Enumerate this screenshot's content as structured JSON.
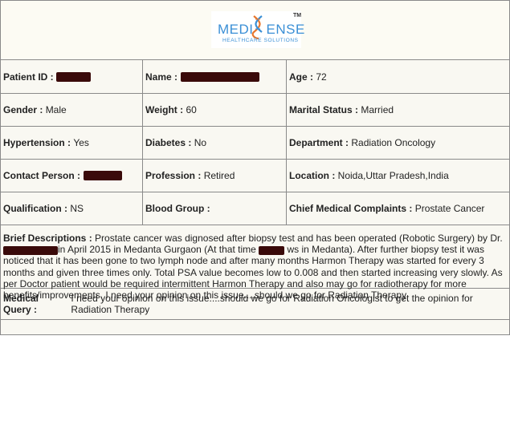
{
  "logo": {
    "brand_left": "MEDI",
    "brand_right": "ENSE",
    "tagline": "HEALTHCARE SOLUTIONS",
    "tm": "TM",
    "icon": "dna-helix-icon",
    "color": "#3a8fd6"
  },
  "fields": {
    "patient_id_label": "Patient ID :",
    "name_label": "Name :",
    "age_label": "Age :",
    "age_value": "72",
    "gender_label": "Gender :",
    "gender_value": "Male",
    "weight_label": "Weight :",
    "weight_value": "60",
    "marital_label": "Marital Status :",
    "marital_value": "Married",
    "hypertension_label": "Hypertension :",
    "hypertension_value": "Yes",
    "diabetes_label": "Diabetes :",
    "diabetes_value": "No",
    "department_label": "Department :",
    "department_value": "Radiation Oncology",
    "contact_label": "Contact Person :",
    "profession_label": "Profession :",
    "profession_value": "Retired",
    "location_label": "Location :",
    "location_value": "Noida,Uttar Pradesh,India",
    "qualification_label": "Qualification :",
    "qualification_value": "NS",
    "blood_group_label": "Blood Group :",
    "blood_group_value": "",
    "complaints_label": "Chief Medical Complaints :",
    "complaints_value": "Prostate Cancer"
  },
  "description": {
    "label": "Brief Descriptions :",
    "part1": "Prostate cancer was dignosed after biopsy test and has been operated (Robotic Surgery) by Dr.",
    "part2": "in April 2015 in Medanta Gurgaon (At that time",
    "part3": "ws in Medanta). After further biopsy test it was noticed that it has been gone to two lymph node and after many months Harmon Therapy was started for every 3 months and given three times only. Total PSA value becomes low to 0.008 and then started increasing very slowly. As per Doctor patient would be required intermittent Harmon Therapy and also may go for radiotherapy for more benefits/improvements. I need your opinion on this issue....should we go for Radiation Therapy"
  },
  "query": {
    "label": "Medical Query :",
    "value": "I need your opinion on this issue....should we go for Radiation Oncologist to get the opinion for Radiation Therapy"
  },
  "colors": {
    "border": "#8a8a8a",
    "redaction": "#3a0a0a",
    "background": "#f9f8f2"
  }
}
